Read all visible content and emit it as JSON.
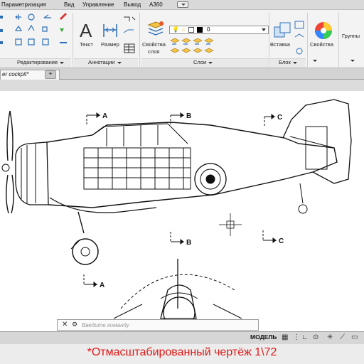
{
  "menu": {
    "items": [
      "Параметризация",
      "Вид",
      "Управление",
      "Вывод",
      "A360"
    ]
  },
  "ribbon": {
    "edit_panel_title": "Редактирование",
    "annotation_panel": {
      "title": "Аннотации",
      "text_label": "Текст",
      "size_label": "Размер"
    },
    "layers_panel": {
      "title": "Слои",
      "properties_label_1": "Свойства",
      "properties_label_2": "слоя",
      "layer_value": "0"
    },
    "block_panel": {
      "title": "Блок",
      "insert_label": "Вставка"
    },
    "properties_label": "Свойства",
    "groups_label": "Группы"
  },
  "tabs": {
    "file_tab": "er cockpit*"
  },
  "drawing": {
    "section_labels": [
      "A",
      "B",
      "C",
      "A",
      "B",
      "C"
    ]
  },
  "command_line": {
    "placeholder": "Введите команду"
  },
  "status_bar": {
    "model_tab": "МОДЕЛЬ"
  },
  "caption": "*Отмасштабированный чертёж 1\\72",
  "colors": {
    "caption": "#e01818",
    "accent_blue": "#2b6fb8"
  }
}
